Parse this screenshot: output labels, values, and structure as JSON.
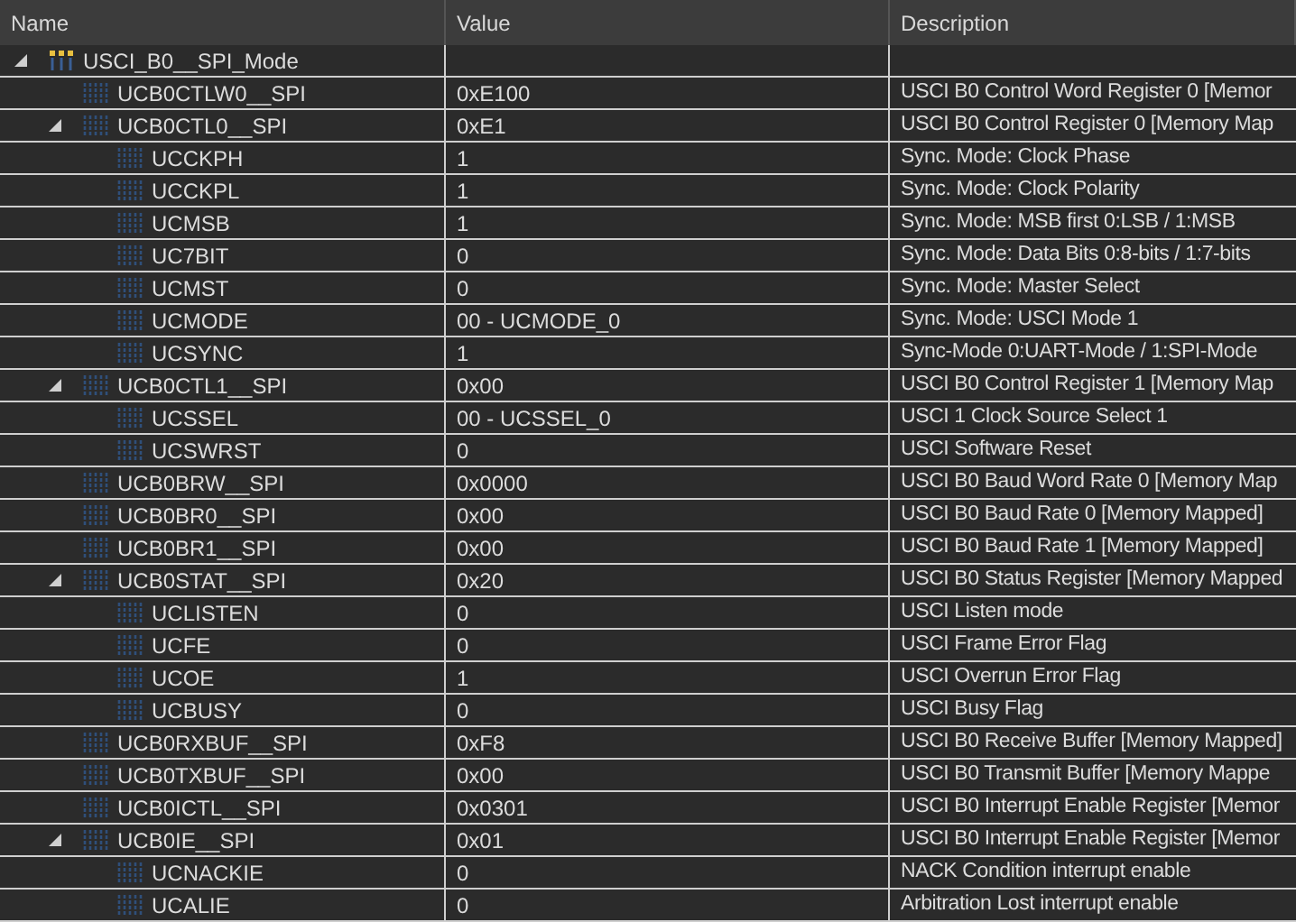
{
  "columns": [
    "Name",
    "Value",
    "Description"
  ],
  "rows": [
    {
      "kind": "group",
      "name": "USCI_B0__SPI_Mode",
      "value": "",
      "description": "",
      "expanded": true,
      "children": [
        {
          "kind": "register",
          "name": "UCB0CTLW0__SPI",
          "value": "0xE100",
          "description": "USCI B0 Control Word Register 0 [Memor"
        },
        {
          "kind": "register",
          "name": "UCB0CTL0__SPI",
          "value": "0xE1",
          "description": "USCI B0 Control Register 0 [Memory Map",
          "expanded": true,
          "children": [
            {
              "kind": "field",
              "name": "UCCKPH",
              "value": "1",
              "description": "Sync. Mode: Clock Phase"
            },
            {
              "kind": "field",
              "name": "UCCKPL",
              "value": "1",
              "description": "Sync. Mode: Clock Polarity"
            },
            {
              "kind": "field",
              "name": "UCMSB",
              "value": "1",
              "description": "Sync. Mode: MSB first 0:LSB / 1:MSB"
            },
            {
              "kind": "field",
              "name": "UC7BIT",
              "value": "0",
              "description": "Sync. Mode: Data Bits 0:8-bits / 1:7-bits"
            },
            {
              "kind": "field",
              "name": "UCMST",
              "value": "0",
              "description": "Sync. Mode: Master Select"
            },
            {
              "kind": "field",
              "name": "UCMODE",
              "value": "00 - UCMODE_0",
              "description": "Sync. Mode: USCI Mode 1"
            },
            {
              "kind": "field",
              "name": "UCSYNC",
              "value": "1",
              "description": "Sync-Mode  0:UART-Mode / 1:SPI-Mode"
            }
          ]
        },
        {
          "kind": "register",
          "name": "UCB0CTL1__SPI",
          "value": "0x00",
          "description": "USCI B0 Control Register 1 [Memory Map",
          "expanded": true,
          "children": [
            {
              "kind": "field",
              "name": "UCSSEL",
              "value": "00 - UCSSEL_0",
              "description": "USCI 1 Clock Source Select 1"
            },
            {
              "kind": "field",
              "name": "UCSWRST",
              "value": "0",
              "description": "USCI Software Reset"
            }
          ]
        },
        {
          "kind": "register",
          "name": "UCB0BRW__SPI",
          "value": "0x0000",
          "description": "USCI B0 Baud Word Rate 0 [Memory Map"
        },
        {
          "kind": "register",
          "name": "UCB0BR0__SPI",
          "value": "0x00",
          "description": "USCI B0 Baud Rate 0 [Memory Mapped]"
        },
        {
          "kind": "register",
          "name": "UCB0BR1__SPI",
          "value": "0x00",
          "description": "USCI B0 Baud Rate 1 [Memory Mapped]"
        },
        {
          "kind": "register",
          "name": "UCB0STAT__SPI",
          "value": "0x20",
          "description": "USCI B0 Status Register [Memory Mapped",
          "expanded": true,
          "children": [
            {
              "kind": "field",
              "name": "UCLISTEN",
              "value": "0",
              "description": "USCI Listen mode"
            },
            {
              "kind": "field",
              "name": "UCFE",
              "value": "0",
              "description": "USCI Frame Error Flag"
            },
            {
              "kind": "field",
              "name": "UCOE",
              "value": "1",
              "description": "USCI Overrun Error Flag"
            },
            {
              "kind": "field",
              "name": "UCBUSY",
              "value": "0",
              "description": "USCI Busy Flag"
            }
          ]
        },
        {
          "kind": "register",
          "name": "UCB0RXBUF__SPI",
          "value": "0xF8",
          "description": "USCI B0 Receive Buffer [Memory Mapped]"
        },
        {
          "kind": "register",
          "name": "UCB0TXBUF__SPI",
          "value": "0x00",
          "description": "USCI B0 Transmit Buffer [Memory Mappe"
        },
        {
          "kind": "register",
          "name": "UCB0ICTL__SPI",
          "value": "0x0301",
          "description": "USCI B0 Interrupt Enable Register [Memor"
        },
        {
          "kind": "register",
          "name": "UCB0IE__SPI",
          "value": "0x01",
          "description": "USCI B0 Interrupt Enable Register [Memor",
          "expanded": true,
          "children": [
            {
              "kind": "field",
              "name": "UCNACKIE",
              "value": "0",
              "description": "NACK Condition interrupt enable"
            },
            {
              "kind": "field",
              "name": "UCALIE",
              "value": "0",
              "description": "Arbitration Lost interrupt enable"
            }
          ]
        }
      ]
    }
  ]
}
